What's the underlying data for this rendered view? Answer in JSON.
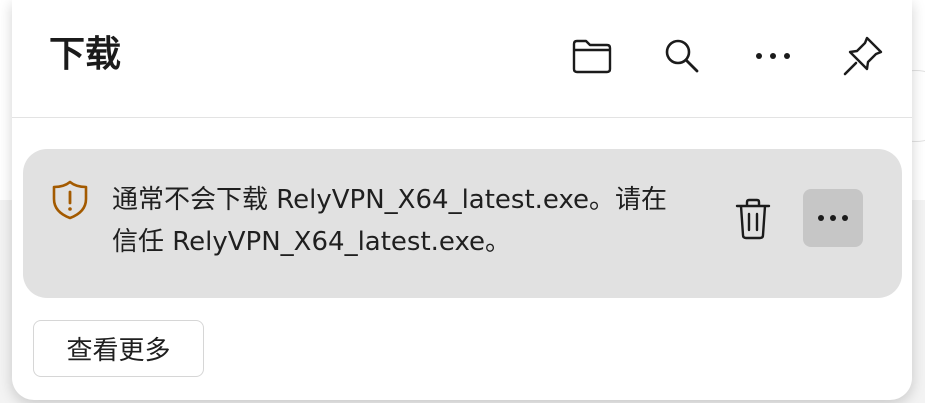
{
  "panel": {
    "title": "下载"
  },
  "header_actions": [
    {
      "name": "open-folder",
      "icon": "folder-icon"
    },
    {
      "name": "search",
      "icon": "search-icon"
    },
    {
      "name": "more-options",
      "icon": "more-horizontal-icon"
    },
    {
      "name": "pin",
      "icon": "pin-icon"
    }
  ],
  "download_item": {
    "status_icon": "shield-warning-icon",
    "message_line1": "通常不会下载 RelyVPN_X64_latest.exe。请在",
    "message_line2": "信任 RelyVPN_X64_latest.exe。",
    "delete_icon": "trash-icon",
    "more_icon": "more-horizontal-icon"
  },
  "footer": {
    "see_more_label": "查看更多"
  },
  "colors": {
    "warning": "#a35a00",
    "card_bg": "#e1e1e1",
    "more_button_bg": "#c6c6c6",
    "text": "#1f1f1f"
  }
}
